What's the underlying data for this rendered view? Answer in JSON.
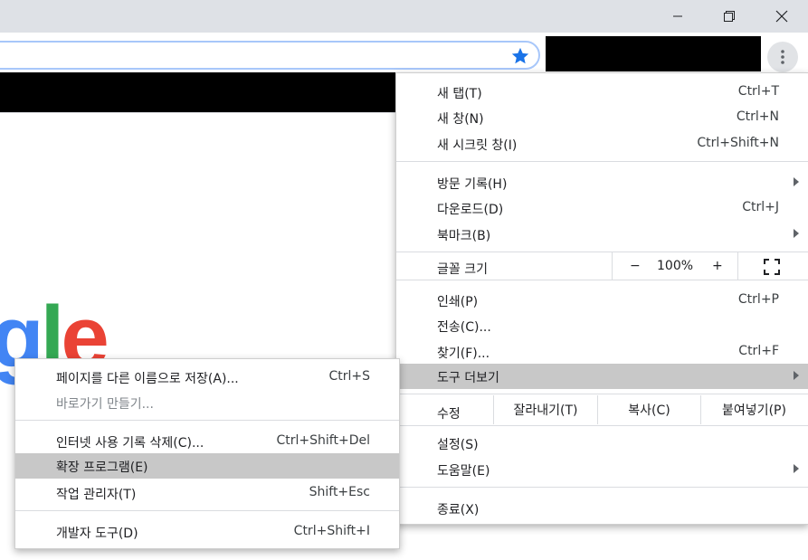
{
  "main_menu": {
    "new_tab": {
      "label": "새 탭(T)",
      "shortcut": "Ctrl+T"
    },
    "new_window": {
      "label": "새 창(N)",
      "shortcut": "Ctrl+N"
    },
    "new_incognito": {
      "label": "새 시크릿 창(I)",
      "shortcut": "Ctrl+Shift+N"
    },
    "history": {
      "label": "방문 기록(H)"
    },
    "downloads": {
      "label": "다운로드(D)",
      "shortcut": "Ctrl+J"
    },
    "bookmarks": {
      "label": "북마크(B)"
    },
    "zoom": {
      "label": "글꼴 크기",
      "minus": "−",
      "value": "100%",
      "plus": "+"
    },
    "print": {
      "label": "인쇄(P)",
      "shortcut": "Ctrl+P"
    },
    "cast": {
      "label": "전송(C)..."
    },
    "find": {
      "label": "찾기(F)...",
      "shortcut": "Ctrl+F"
    },
    "more_tools": {
      "label": "도구 더보기"
    },
    "edit": {
      "label": "수정",
      "cut": "잘라내기(T)",
      "copy": "복사(C)",
      "paste": "붙여넣기(P)"
    },
    "settings": {
      "label": "설정(S)"
    },
    "help": {
      "label": "도움말(E)"
    },
    "exit": {
      "label": "종료(X)"
    }
  },
  "sub_menu": {
    "save_page": {
      "label": "페이지를 다른 이름으로 저장(A)...",
      "shortcut": "Ctrl+S"
    },
    "create_shortcut": {
      "label": "바로가기 만들기..."
    },
    "clear_browsing": {
      "label": "인터넷 사용 기록 삭제(C)...",
      "shortcut": "Ctrl+Shift+Del"
    },
    "extensions": {
      "label": "확장 프로그램(E)"
    },
    "task_manager": {
      "label": "작업 관리자(T)",
      "shortcut": "Shift+Esc"
    },
    "developer_tools": {
      "label": "개발자 도구(D)",
      "shortcut": "Ctrl+Shift+I"
    }
  },
  "page": {
    "logo_g": "g",
    "logo_l": "l",
    "logo_e": "e"
  },
  "colors": {
    "accent": "#1a73e8",
    "highlight": "#c8c8c8"
  }
}
